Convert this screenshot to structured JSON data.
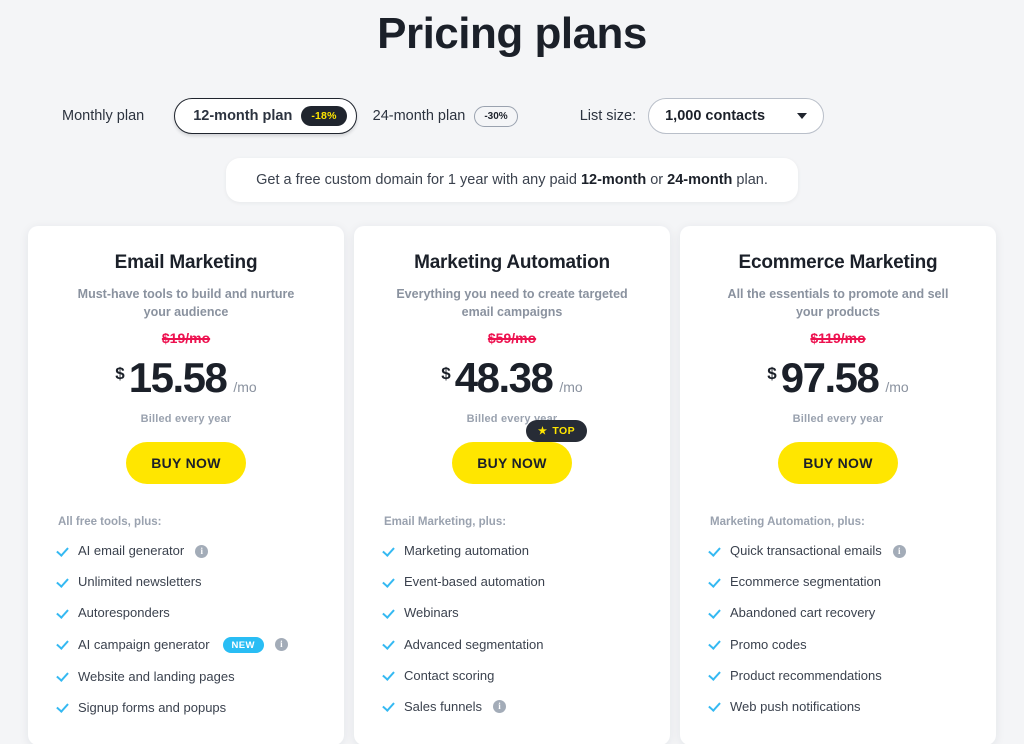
{
  "page": {
    "title": "Pricing plans"
  },
  "selector": {
    "monthly_label": "Monthly plan",
    "twelve_month_label": "12-month plan",
    "twelve_month_badge": "-18%",
    "twentyfour_month_label": "24-month plan",
    "twentyfour_month_badge": "-30%",
    "list_size_label": "List size:",
    "list_size_value": "1,000 contacts",
    "chevron_icon": "chevron-down-icon"
  },
  "promo": {
    "prefix": "Get a free custom domain for 1 year with any paid ",
    "bold_one": "12-month",
    "middle": " or ",
    "bold_two": "24-month",
    "suffix": " plan."
  },
  "colors": {
    "accent_yellow": "#ffe600",
    "dark": "#20252e",
    "old_price_red": "#ed1250",
    "check_blue": "#35b9f2",
    "new_badge_blue": "#29bdf4",
    "muted": "#8a929f",
    "page_bg": "#f4f5f7"
  },
  "cards": [
    {
      "title": "Email Marketing",
      "subtitle": "Must-have tools to build and nurture your audience",
      "old_price": "$19/mo",
      "currency": "$",
      "amount": "15.58",
      "per": "/mo",
      "billed": "Billed every year",
      "cta": "BUY NOW",
      "top_badge": null,
      "features_head": "All free tools, plus:",
      "features": [
        {
          "label": "AI email generator",
          "info": true,
          "new": false
        },
        {
          "label": "Unlimited newsletters",
          "info": false,
          "new": false
        },
        {
          "label": "Autoresponders",
          "info": false,
          "new": false
        },
        {
          "label": "AI campaign generator",
          "info": true,
          "new": true,
          "new_label": "NEW"
        },
        {
          "label": "Website and landing pages",
          "info": false,
          "new": false
        },
        {
          "label": "Signup forms and popups",
          "info": false,
          "new": false
        }
      ]
    },
    {
      "title": "Marketing Automation",
      "subtitle": "Everything you need to create targeted email campaigns",
      "old_price": "$59/mo",
      "currency": "$",
      "amount": "48.38",
      "per": "/mo",
      "billed": "Billed every year",
      "cta": "BUY NOW",
      "top_badge": "TOP",
      "features_head": "Email Marketing, plus:",
      "features": [
        {
          "label": "Marketing automation",
          "info": false,
          "new": false
        },
        {
          "label": "Event-based automation",
          "info": false,
          "new": false
        },
        {
          "label": "Webinars",
          "info": false,
          "new": false
        },
        {
          "label": "Advanced segmentation",
          "info": false,
          "new": false
        },
        {
          "label": "Contact scoring",
          "info": false,
          "new": false
        },
        {
          "label": "Sales funnels",
          "info": true,
          "new": false
        }
      ]
    },
    {
      "title": "Ecommerce Marketing",
      "subtitle": "All the essentials to promote and sell your products",
      "old_price": "$119/mo",
      "currency": "$",
      "amount": "97.58",
      "per": "/mo",
      "billed": "Billed every year",
      "cta": "BUY NOW",
      "top_badge": null,
      "features_head": "Marketing Automation, plus:",
      "features": [
        {
          "label": "Quick transactional emails",
          "info": true,
          "new": false
        },
        {
          "label": "Ecommerce segmentation",
          "info": false,
          "new": false
        },
        {
          "label": "Abandoned cart recovery",
          "info": false,
          "new": false
        },
        {
          "label": "Promo codes",
          "info": false,
          "new": false
        },
        {
          "label": "Product recommendations",
          "info": false,
          "new": false
        },
        {
          "label": "Web push notifications",
          "info": false,
          "new": false
        }
      ]
    }
  ]
}
